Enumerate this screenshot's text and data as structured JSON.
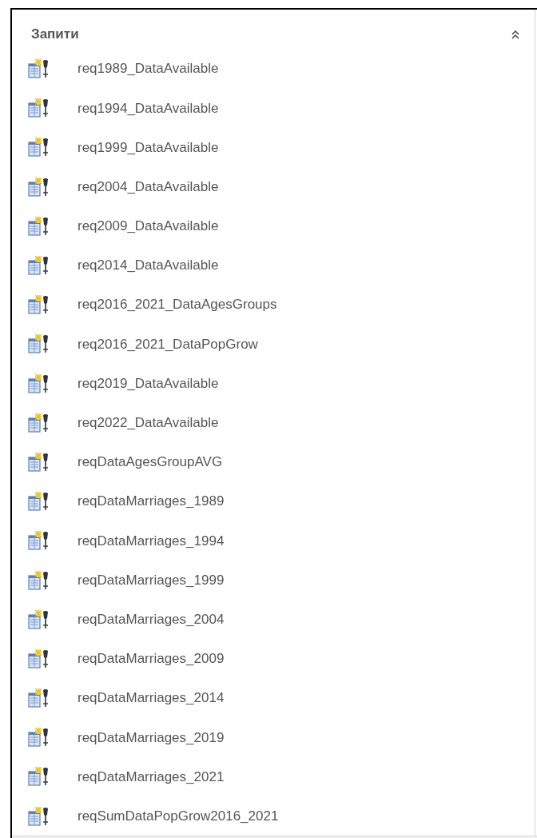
{
  "group": {
    "title": "Запити",
    "expanded": true,
    "items": [
      "req1989_DataAvailable",
      "req1994_DataAvailable",
      "req1999_DataAvailable",
      "req2004_DataAvailable",
      "req2009_DataAvailable",
      "req2014_DataAvailable",
      "req2016_2021_DataAgesGroups",
      "req2016_2021_DataPopGrow",
      "req2019_DataAvailable",
      "req2022_DataAvailable",
      "reqDataAgesGroupAVG",
      "reqDataMarriages_1989",
      "reqDataMarriages_1994",
      "reqDataMarriages_1999",
      "reqDataMarriages_2004",
      "reqDataMarriages_2009",
      "reqDataMarriages_2014",
      "reqDataMarriages_2019",
      "reqDataMarriages_2021",
      "reqSumDataPopGrow2016_2021"
    ]
  }
}
